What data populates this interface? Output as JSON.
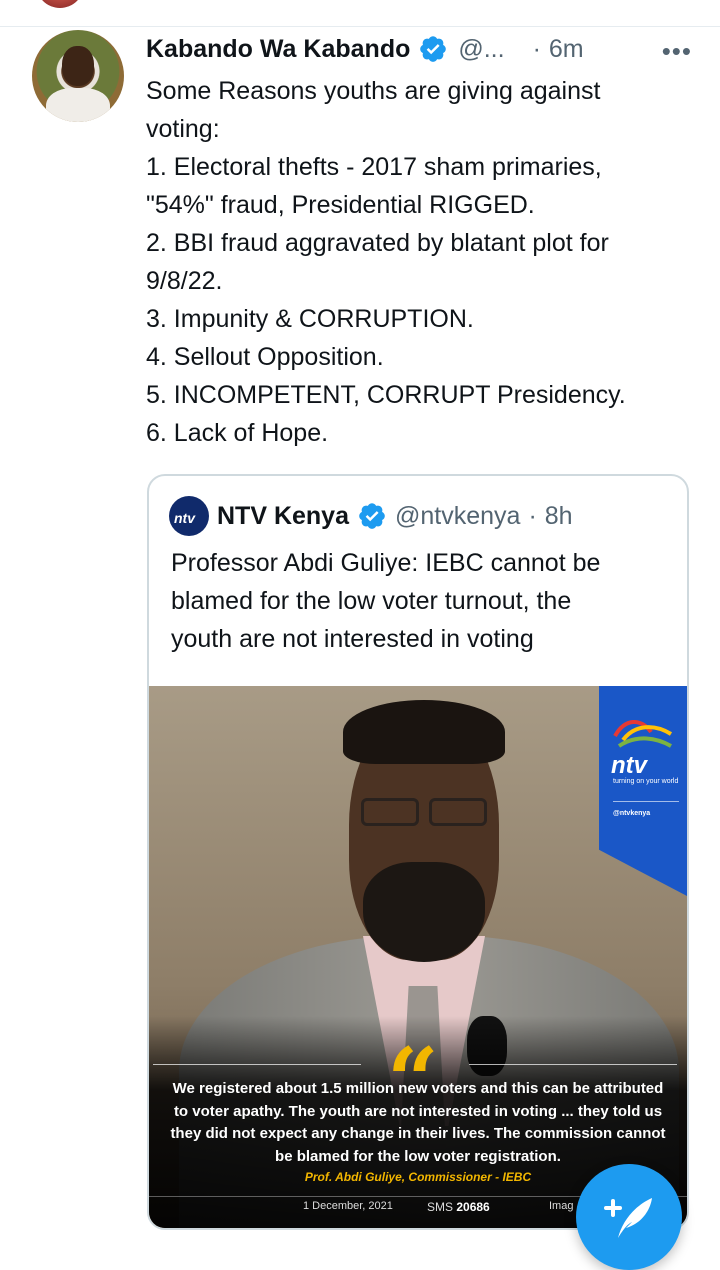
{
  "tweet": {
    "author_name": "Kabando Wa Kabando",
    "handle": "@...",
    "separator": "·",
    "time": "6m",
    "more_label": "•••",
    "lines": [
      "Some Reasons youths are giving against",
      "voting:",
      "1. Electoral thefts - 2017 sham primaries,",
      "\"54%\" fraud, Presidential RIGGED.",
      "2. BBI fraud aggravated by blatant plot for",
      "9/8/22.",
      "3. Impunity & CORRUPTION.",
      "4. Sellout Opposition.",
      "5. INCOMPETENT, CORRUPT Presidency.",
      "6. Lack of Hope."
    ]
  },
  "quoted": {
    "author_name": "NTV Kenya",
    "handle": "@ntvkenya",
    "separator": "·",
    "time": "8h",
    "avatar_text": "ntv",
    "text_lines": [
      "Professor Abdi Guliye: IEBC cannot be",
      "blamed for the low voter turnout, the",
      "youth are not interested in voting"
    ],
    "media": {
      "brand_word": "ntv",
      "brand_tagline": "turning on your world",
      "social_handle": "@ntvkenya",
      "quote_mark": "“",
      "statement_lines": [
        "We registered about 1.5 million new voters and this can be attributed",
        "to voter apathy. The youth are not interested in voting ... they told us",
        "they did not expect any change in their lives. The commission cannot",
        "be blamed for the low voter registration."
      ],
      "attribution": "Prof. Abdi Guliye, Commissioner - IEBC",
      "date": "1 December, 2021",
      "sms_label": "SMS",
      "sms_number": "20686",
      "credit": "Imag"
    }
  },
  "fab": {
    "icon": "compose-feather-icon"
  },
  "colors": {
    "twitter_blue": "#1d9bf0",
    "ntv_blue": "#1a57c7",
    "quote_gold": "#f2b600",
    "muted_text": "#536471"
  }
}
